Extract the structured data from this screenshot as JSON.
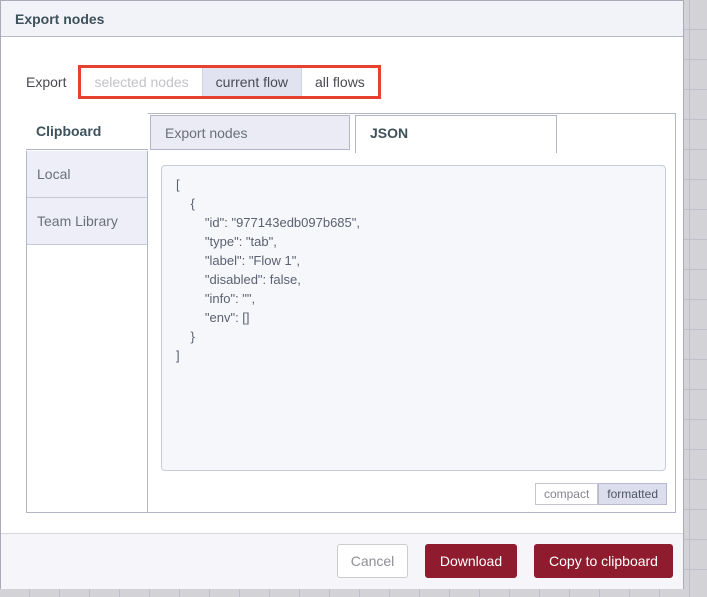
{
  "dialog": {
    "title": "Export nodes"
  },
  "export_row": {
    "label": "Export",
    "options": [
      {
        "label": "selected nodes",
        "state": "disabled"
      },
      {
        "label": "current flow",
        "state": "selected"
      },
      {
        "label": "all flows",
        "state": "normal"
      }
    ]
  },
  "library": {
    "header": "Clipboard",
    "sidebar_items": [
      {
        "label": "Local"
      },
      {
        "label": "Team Library"
      }
    ],
    "tabs": [
      {
        "label": "Export nodes",
        "active": false
      },
      {
        "label": "JSON",
        "active": true
      }
    ]
  },
  "editor": {
    "code_text": "[\n    {\n        \"id\": \"977143edb097b685\",\n        \"type\": \"tab\",\n        \"label\": \"Flow 1\",\n        \"disabled\": false,\n        \"info\": \"\",\n        \"env\": []\n    }\n]",
    "flow": {
      "id": "977143edb097b685",
      "type": "tab",
      "label": "Flow 1",
      "disabled": "false",
      "info": "",
      "env": "[]"
    },
    "format_buttons": [
      {
        "label": "compact",
        "selected": false
      },
      {
        "label": "formatted",
        "selected": true
      }
    ]
  },
  "footer": {
    "cancel_label": "Cancel",
    "download_label": "Download",
    "copy_label": "Copy to clipboard"
  },
  "colors": {
    "primary_button": "#8e1c2e",
    "annotation_red": "#e6402e",
    "selected_option_bg": "#e2e3f1",
    "header_bg": "#f2f2f9",
    "code_bg": "#f6f7fb",
    "workspace_bg": "#d2d2d7"
  }
}
